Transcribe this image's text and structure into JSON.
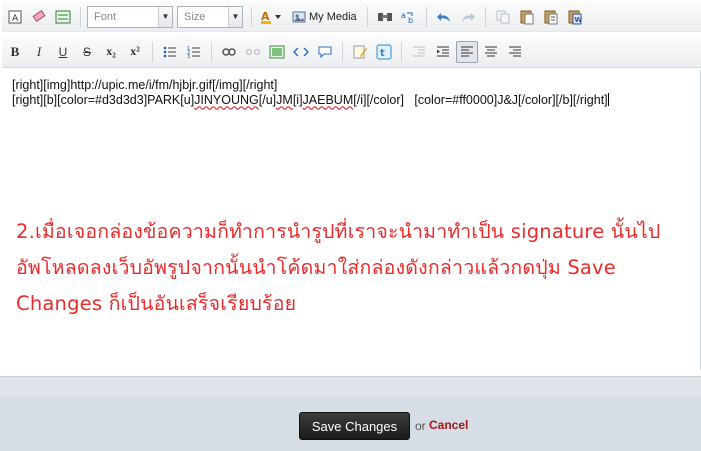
{
  "toolbar": {
    "font_placeholder": "Font",
    "size_placeholder": "Size",
    "my_media_label": "My Media",
    "bold_label": "B",
    "italic_label": "I",
    "underline_label": "U",
    "strike_label": "S",
    "subscript_label": "x₂",
    "superscript_label": "x²",
    "active_alignment": "align-center"
  },
  "editor": {
    "lines": [
      "[right][img]http://upic.me/i/fm/hjbjr.gif[/img][/right]",
      "[right][b][color=#d3d3d3]PARK[u]JINYOUNG[/u]JM[i]JAEBUM[/i][/color]   [color=#ff0000]J&J[/color][/b][/right]"
    ],
    "line2_parts": {
      "a": "[right][b][color=#d3d3d3]PARK[u]",
      "b": "JINYOUNG",
      "c": "[/u]",
      "d": "JM",
      "e": "[i]",
      "f": "JAEBUM",
      "g": "[/i][/color]   [color=#ff0000]J&J[/color][/b][/right]"
    },
    "note": "2.เมื่อเจอกล่องข้อความก็ทำการนำรูปที่เราจะนำมาทำเป็น signature นั้นไปอัพโหลดลงเว็บอัพรูปจากนั้นนำโค้ดมาใส่กล่องดังกล่าวแล้วกดปุ่ม Save Changes ก็เป็นอันเสร็จเรียบร้อย",
    "note_color": "#ec2a2a"
  },
  "footer": {
    "save_label": "Save Changes",
    "or_label": "or",
    "cancel_label": "Cancel"
  }
}
